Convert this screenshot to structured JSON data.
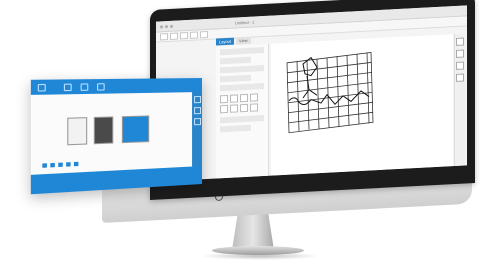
{
  "window": {
    "title": "Untitled - 1"
  },
  "tabs": [
    {
      "label": "Layout"
    },
    {
      "label": "View"
    }
  ],
  "floating_panel": {
    "title": "",
    "labels": [
      "",
      "",
      ""
    ],
    "footer": [
      "",
      "",
      "",
      ""
    ]
  },
  "colors": {
    "accent": "#1f87d6",
    "bezel": "#1c1c1c"
  },
  "icons": [
    "gear-icon",
    "grid-icon",
    "pen-icon",
    "zoom-icon"
  ]
}
